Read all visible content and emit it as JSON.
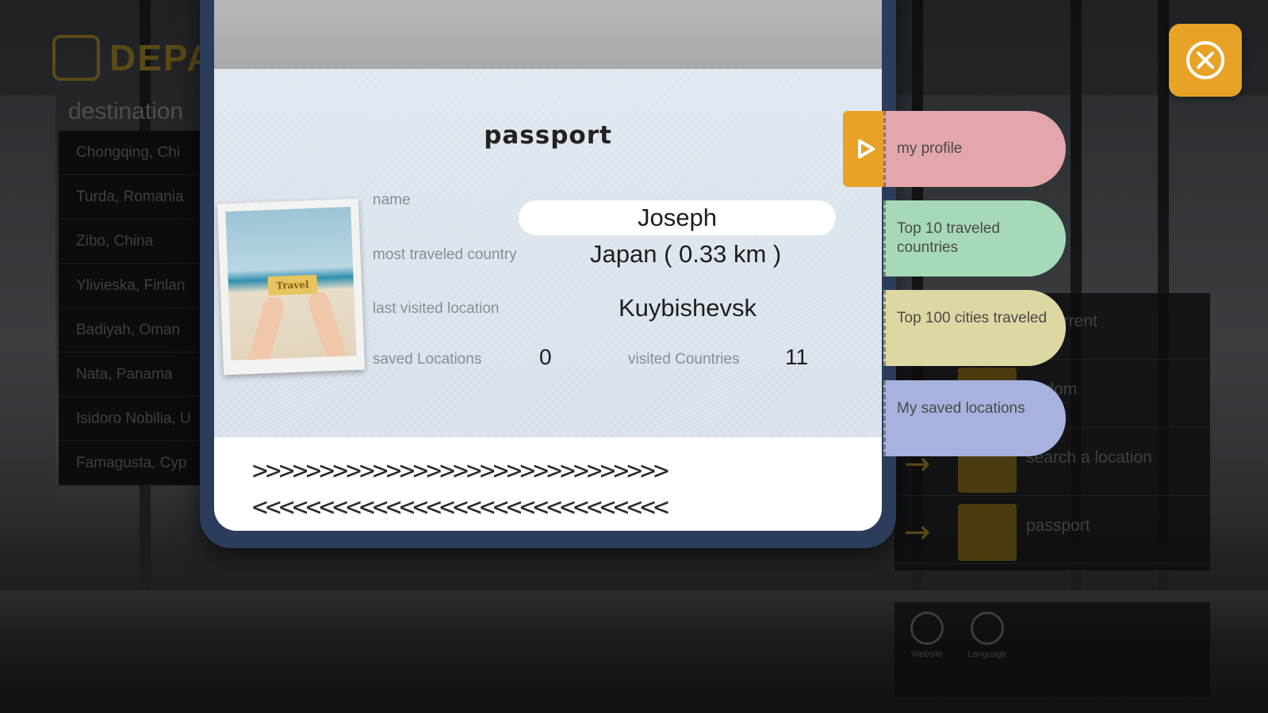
{
  "background": {
    "departures_title": "DEPA",
    "destinations_heading": "destination",
    "destinations": [
      "Chongqing, Chi",
      "Turda, Romania",
      "Zibo, China",
      "Ylivieska, Finlan",
      "Badiyah, Oman",
      "Nata, Panama",
      "Isidoro Nobilia, U",
      "Famagusta, Cyp"
    ],
    "side_menu": [
      {
        "label": "ur current",
        "icon": "location-icon"
      },
      {
        "label": "andom",
        "icon": "dice-icon"
      },
      {
        "label": "search a location",
        "icon": "search-icon"
      },
      {
        "label": "passport",
        "icon": "passport-icon"
      }
    ],
    "bottom_icons": [
      {
        "label": "Website",
        "icon": "user-icon"
      },
      {
        "label": "Language",
        "icon": "globe-icon"
      }
    ]
  },
  "passport": {
    "title": "passport",
    "photo_sign": "Travel",
    "name_label": "name",
    "name_value": "Joseph",
    "most_traveled_label": "most traveled country",
    "most_traveled_value": "Japan ( 0.33 km )",
    "last_visited_label": "last visited location",
    "last_visited_value": "Kuybishevsk",
    "saved_locations_label": "saved Locations",
    "saved_locations_value": "0",
    "visited_countries_label": "visited Countries",
    "visited_countries_value": "11",
    "mrz_line_1": ">>>>>>>>>>>>>>>>>>>>>>>>>>>>>>>",
    "mrz_line_2": "<<<<<<<<<<<<<<<<<<<<<<<<<<<<<<<"
  },
  "tabs": [
    {
      "label": "my profile",
      "color": "#e3a6aa"
    },
    {
      "label": "Top 10 traveled countries",
      "color": "#a6d9b7"
    },
    {
      "label": "Top 100 cities traveled",
      "color": "#ddd7a2"
    },
    {
      "label": "My saved locations",
      "color": "#a7b3de"
    }
  ],
  "colors": {
    "accent": "#e8a225",
    "passport_cover": "#2c3d5c"
  },
  "icons": {
    "close": "close-icon",
    "tab_toggle": "play-icon"
  }
}
